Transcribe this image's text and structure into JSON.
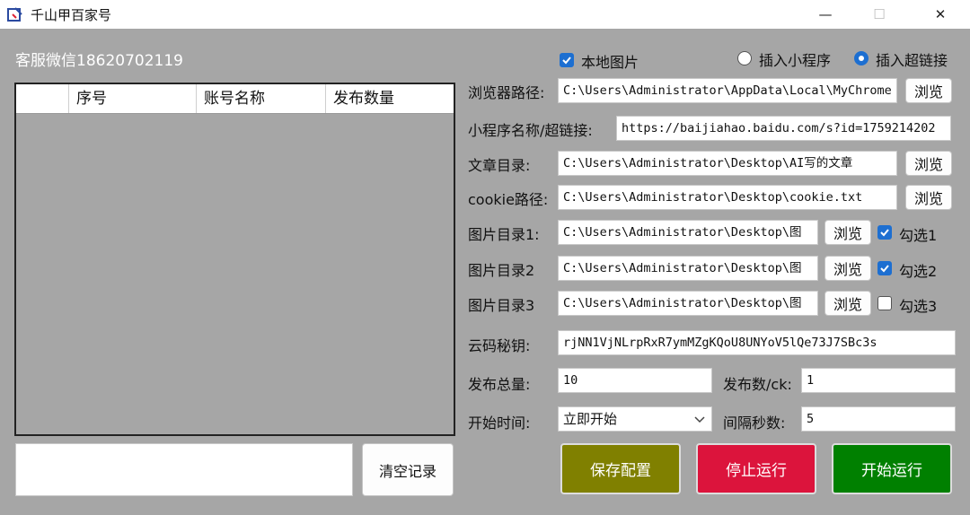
{
  "window": {
    "title": "千山甲百家号",
    "minimize": "—",
    "maximize": "☐",
    "close": "✕"
  },
  "service_contact": "客服微信18620702119",
  "table": {
    "columns": [
      "",
      "序号",
      "账号名称",
      "发布数量"
    ]
  },
  "log_input": {
    "value": ""
  },
  "clear_button": "清空记录",
  "options": {
    "local_images": {
      "label": "本地图片",
      "checked": true
    },
    "insert_miniprogram": {
      "label": "插入小程序",
      "selected": false
    },
    "insert_hyperlink": {
      "label": "插入超链接",
      "selected": true
    }
  },
  "browser_path": {
    "label": "浏览器路径:",
    "value": "C:\\Users\\Administrator\\AppData\\Local\\MyChrome",
    "browse": "浏览"
  },
  "link": {
    "label": "小程序名称/超链接:",
    "value": "https://baijiahao.baidu.com/s?id=1759214202"
  },
  "article_dir": {
    "label": "文章目录:",
    "value": "C:\\Users\\Administrator\\Desktop\\AI写的文章",
    "browse": "浏览"
  },
  "cookie_path": {
    "label": "cookie路径:",
    "value": "C:\\Users\\Administrator\\Desktop\\cookie.txt",
    "browse": "浏览"
  },
  "image_dirs": [
    {
      "label": "图片目录1:",
      "value": "C:\\Users\\Administrator\\Desktop\\图",
      "browse": "浏览",
      "check_label": "勾选1",
      "checked": true
    },
    {
      "label": "图片目录2",
      "value": "C:\\Users\\Administrator\\Desktop\\图",
      "browse": "浏览",
      "check_label": "勾选2",
      "checked": true
    },
    {
      "label": "图片目录3",
      "value": "C:\\Users\\Administrator\\Desktop\\图",
      "browse": "浏览",
      "check_label": "勾选3",
      "checked": false
    }
  ],
  "captcha_key": {
    "label": "云码秘钥:",
    "value": "rjNN1VjNLrpRxR7ymMZgKQoU8UNYoV5lQe73J7SBc3s"
  },
  "total_posts": {
    "label": "发布总量:",
    "value": "10"
  },
  "posts_per_ck": {
    "label": "发布数/ck:",
    "value": "1"
  },
  "start_time": {
    "label": "开始时间:",
    "value": "立即开始"
  },
  "interval": {
    "label": "间隔秒数:",
    "value": "5"
  },
  "actions": {
    "save": "保存配置",
    "stop": "停止运行",
    "start": "开始运行"
  },
  "colors": {
    "save": "#808000",
    "stop": "#dc143c",
    "start": "#008000",
    "accent": "#1d6fd1",
    "background": "#a6a6a6"
  }
}
